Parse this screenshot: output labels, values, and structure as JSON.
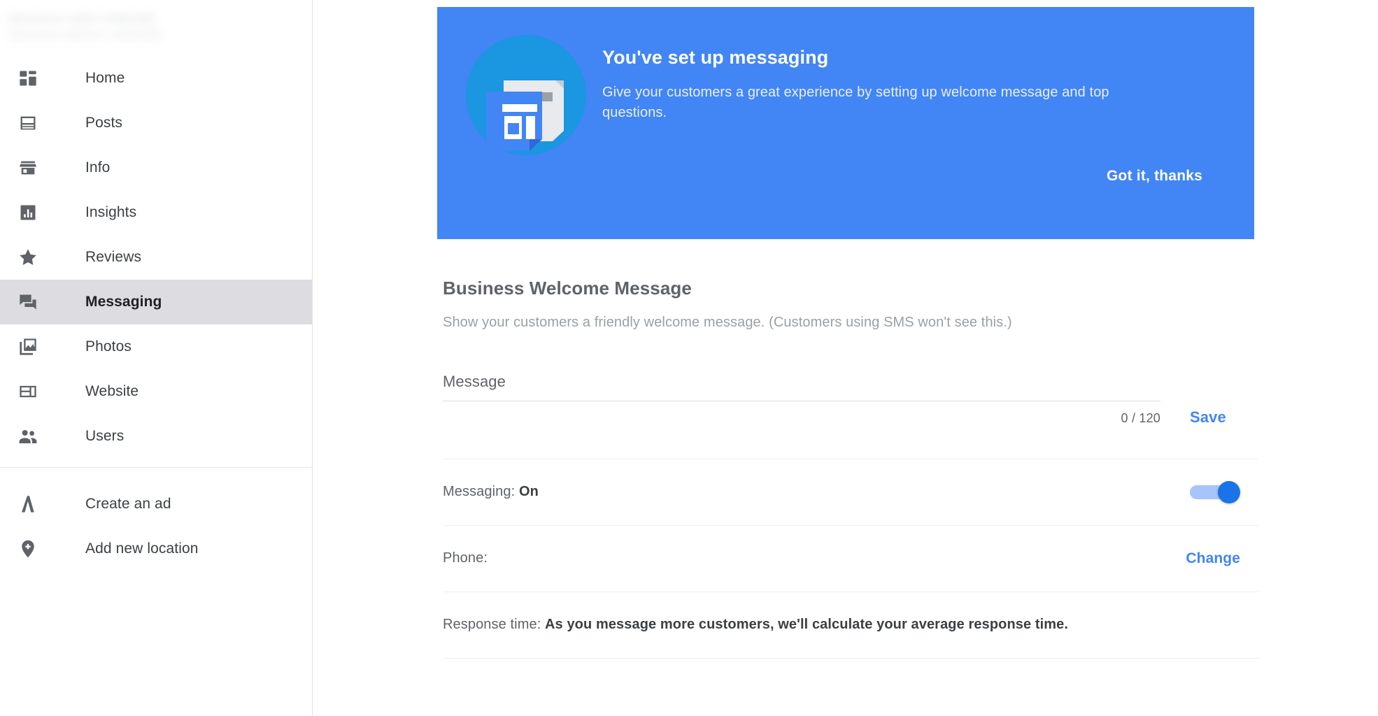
{
  "colors": {
    "accent": "#4285f4",
    "banner_bg": "#4285f4",
    "banner_icon_circle": "#1b96e0",
    "toggle_on": "#1a73e8",
    "toggle_track": "#a7c5fb",
    "active_nav_bg": "#dcdce1",
    "text_primary": "#3c4043",
    "text_secondary": "#5f6368",
    "text_muted": "#9aa0a6"
  },
  "sidebar": {
    "business": {
      "name": "[business name redacted]",
      "address": "[business address redacted]",
      "redacted": true
    },
    "groups": [
      {
        "items": [
          {
            "label": "Home",
            "icon": "dashboard-icon",
            "active": false
          },
          {
            "label": "Posts",
            "icon": "posts-icon",
            "active": false
          },
          {
            "label": "Info",
            "icon": "storefront-icon",
            "active": false
          },
          {
            "label": "Insights",
            "icon": "bar-chart-icon",
            "active": false
          },
          {
            "label": "Reviews",
            "icon": "star-icon",
            "active": false
          },
          {
            "label": "Messaging",
            "icon": "chat-bubbles-icon",
            "active": true
          },
          {
            "label": "Photos",
            "icon": "photo-library-icon",
            "active": false
          },
          {
            "label": "Website",
            "icon": "web-layout-icon",
            "active": false
          },
          {
            "label": "Users",
            "icon": "people-icon",
            "active": false
          }
        ]
      },
      {
        "items": [
          {
            "label": "Create an ad",
            "icon": "adwords-icon",
            "active": false
          },
          {
            "label": "Add new location",
            "icon": "add-place-icon",
            "active": false
          }
        ]
      }
    ]
  },
  "banner": {
    "title": "You've set up messaging",
    "description": "Give your customers a great experience by setting up welcome message and top questions.",
    "cta_label": "Got it, thanks",
    "icon": "business-messages-icon"
  },
  "section": {
    "title": "Business Welcome Message",
    "subtitle": "Show your customers a friendly welcome message. (Customers using SMS won't see this.)",
    "message_field": {
      "label": "Message",
      "value": "",
      "placeholder": "",
      "counter": "0 / 120",
      "max_length": 120,
      "save_label": "Save"
    },
    "rows": [
      {
        "name": "messaging-status-row",
        "label_prefix": "Messaging: ",
        "label_value": "On",
        "control": "toggle",
        "toggle_on": true
      },
      {
        "name": "phone-row",
        "label_prefix": "Phone:",
        "label_value": "",
        "control": "link",
        "action_label": "Change"
      },
      {
        "name": "response-time-row",
        "label_prefix": "Response time: ",
        "label_value": "As you message more customers, we'll calculate your average response time.",
        "control": "none",
        "action_label": ""
      }
    ]
  }
}
